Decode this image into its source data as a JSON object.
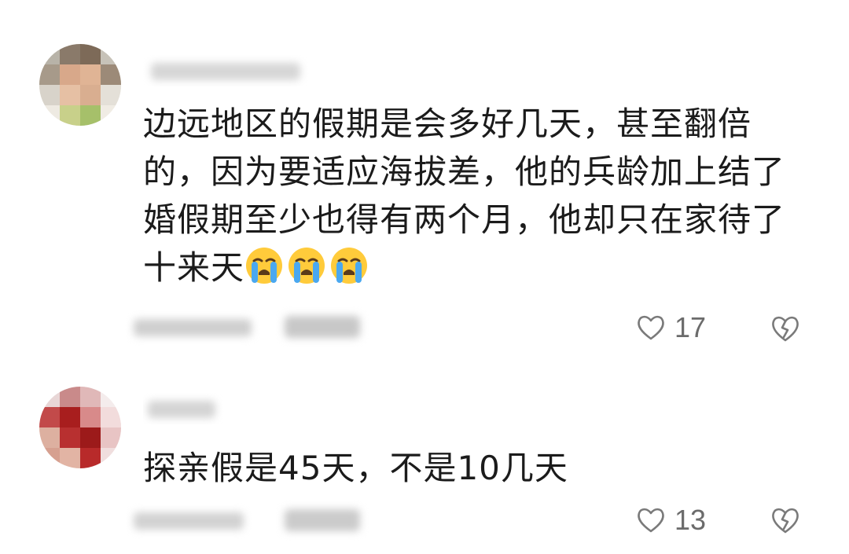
{
  "comments": [
    {
      "text": "边远地区的假期是会多好几天，甚至翻倍的，因为要适应海拔差，他的兵龄加上结了婚假期至少也得有两个月，他却只在家待了十来天",
      "emoji_count": 3,
      "emoji_icon": "loudly-crying-face-icon",
      "likes": "17"
    },
    {
      "text": "探亲假是45天，不是10几天",
      "likes": "13"
    }
  ],
  "colors": {
    "text": "#1b1b1b",
    "meta": "#6b6b6b",
    "icon": "#7a7a7a"
  }
}
